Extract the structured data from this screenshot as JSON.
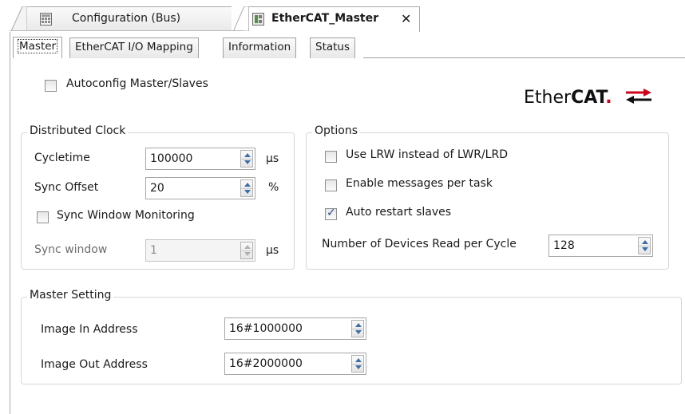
{
  "doc_tabs": [
    {
      "label": "Configuration (Bus)",
      "icon": "config-grid-icon"
    },
    {
      "label": "EtherCAT_Master",
      "icon": "device-icon",
      "close": "✕"
    }
  ],
  "sub_tabs": [
    "Master",
    "EtherCAT I/O Mapping",
    "Information",
    "Status"
  ],
  "autoconfig": {
    "label": "Autoconfig Master/Slaves",
    "checked": false
  },
  "logo": {
    "text_regular": "Ether",
    "text_bold": "CAT",
    "dot": ".",
    "accent": "#d0021b"
  },
  "distributed_clock": {
    "title": "Distributed Clock",
    "cycletime": {
      "label": "Cycletime",
      "value": "100000",
      "unit": "µs"
    },
    "sync_offset": {
      "label": "Sync Offset",
      "value": "20",
      "unit": "%"
    },
    "sync_window_monitoring": {
      "label": "Sync Window Monitoring",
      "checked": false
    },
    "sync_window": {
      "label": "Sync window",
      "value": "1",
      "unit": "µs"
    }
  },
  "options": {
    "title": "Options",
    "use_lrw": {
      "label": "Use LRW instead of LWR/LRD",
      "checked": false
    },
    "enable_messages": {
      "label": "Enable messages per task",
      "checked": false
    },
    "auto_restart": {
      "label": "Auto restart slaves",
      "checked": true
    },
    "devices_read": {
      "label": "Number of Devices Read per Cycle",
      "value": "128"
    }
  },
  "master_setting": {
    "title": "Master Setting",
    "image_in": {
      "label": "Image In Address",
      "value": "16#1000000"
    },
    "image_out": {
      "label": "Image Out Address",
      "value": "16#2000000"
    }
  }
}
